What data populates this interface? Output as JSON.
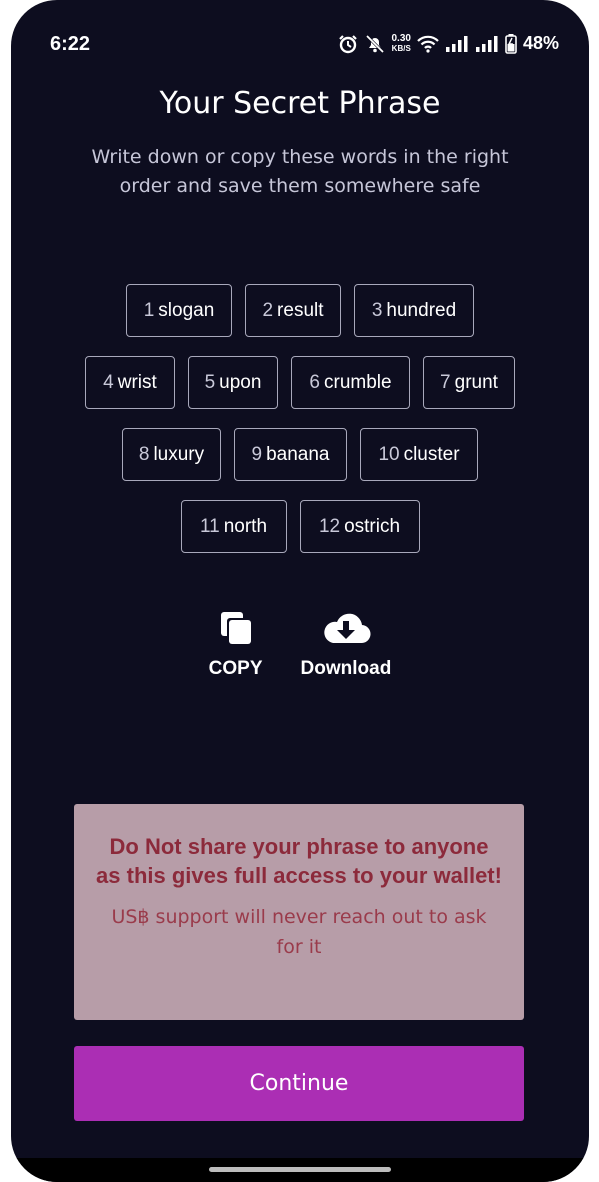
{
  "status_bar": {
    "time": "6:22",
    "net_speed_value": "0.30",
    "net_speed_unit": "KB/S",
    "battery_percent": "48%",
    "icons": [
      "alarm-icon",
      "mute-icon",
      "wifi-icon",
      "signal-icon",
      "signal-icon",
      "battery-charging-icon"
    ]
  },
  "header": {
    "title": "Your Secret Phrase",
    "subtitle": "Write down or copy these words in the right order and save them somewhere safe"
  },
  "phrase_words": [
    {
      "num": "1",
      "word": "slogan"
    },
    {
      "num": "2",
      "word": "result"
    },
    {
      "num": "3",
      "word": "hundred"
    },
    {
      "num": "4",
      "word": "wrist"
    },
    {
      "num": "5",
      "word": "upon"
    },
    {
      "num": "6",
      "word": "crumble"
    },
    {
      "num": "7",
      "word": "grunt"
    },
    {
      "num": "8",
      "word": "luxury"
    },
    {
      "num": "9",
      "word": "banana"
    },
    {
      "num": "10",
      "word": "cluster"
    },
    {
      "num": "11",
      "word": "north"
    },
    {
      "num": "12",
      "word": "ostrich"
    }
  ],
  "actions": {
    "copy_label": "COPY",
    "download_label": "Download",
    "copy_icon": "copy-icon",
    "download_icon": "cloud-download-icon"
  },
  "warning": {
    "main_text": "Do Not share your phrase to anyone as this gives full access to your wallet!",
    "sub_text": "US฿ support will never reach out to ask for it"
  },
  "continue_label": "Continue",
  "colors": {
    "background": "#0d0d1f",
    "accent": "#ab2eb4",
    "warning_bg": "#b79da8",
    "warning_text": "#8c2a3b"
  }
}
